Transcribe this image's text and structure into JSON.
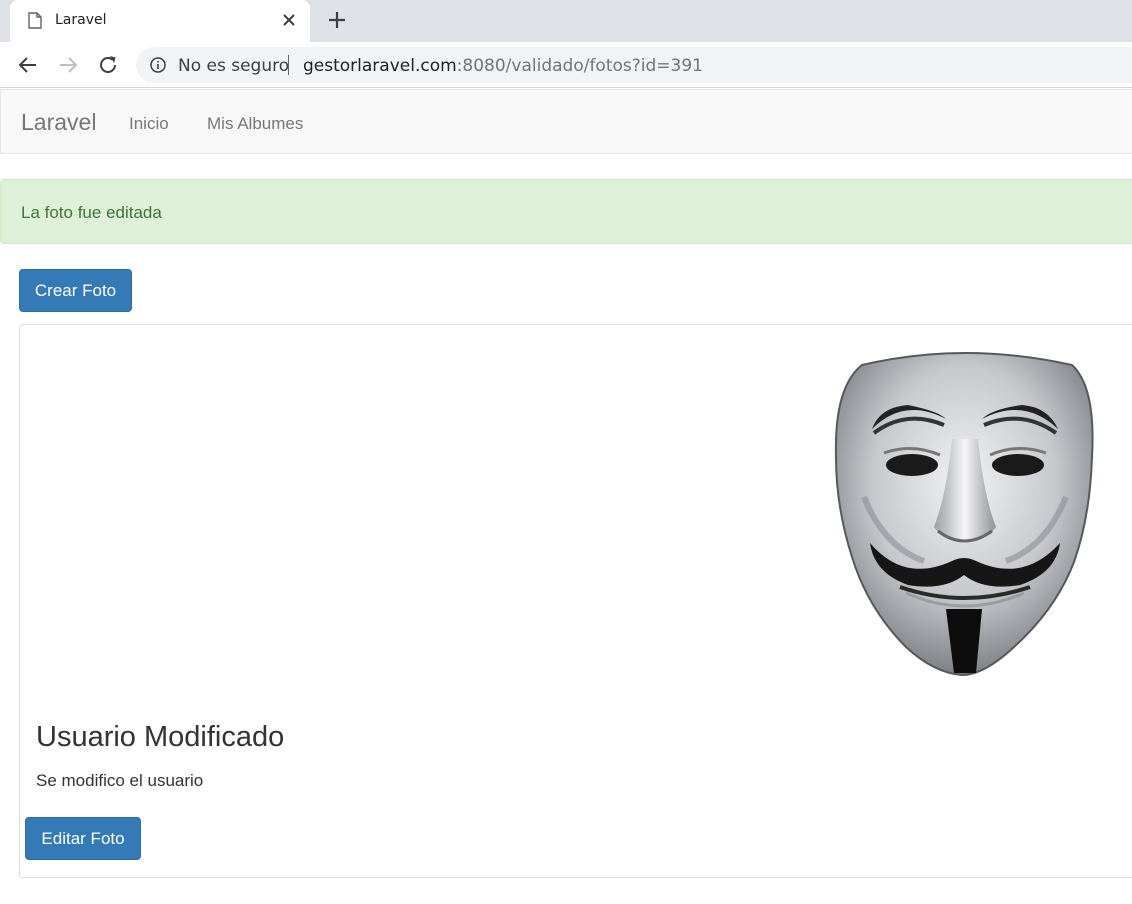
{
  "browser": {
    "tab_title": "Laravel",
    "security_label": "No es seguro",
    "url_host": "gestorlaravel.com",
    "url_rest": ":8080/validado/fotos?id=391"
  },
  "navbar": {
    "brand": "Laravel",
    "links": [
      "Inicio",
      "Mis Albumes"
    ]
  },
  "alert": {
    "message": "La foto fue editada",
    "color": "#3c763d",
    "background": "#dff0d8"
  },
  "actions": {
    "create_label": "Crear Foto",
    "edit_label": "Editar Foto",
    "button_color": "#337ab7"
  },
  "photo": {
    "icon": "guy-fawkes-mask-image",
    "title": "Usuario Modificado",
    "description": "Se modifico el usuario"
  }
}
